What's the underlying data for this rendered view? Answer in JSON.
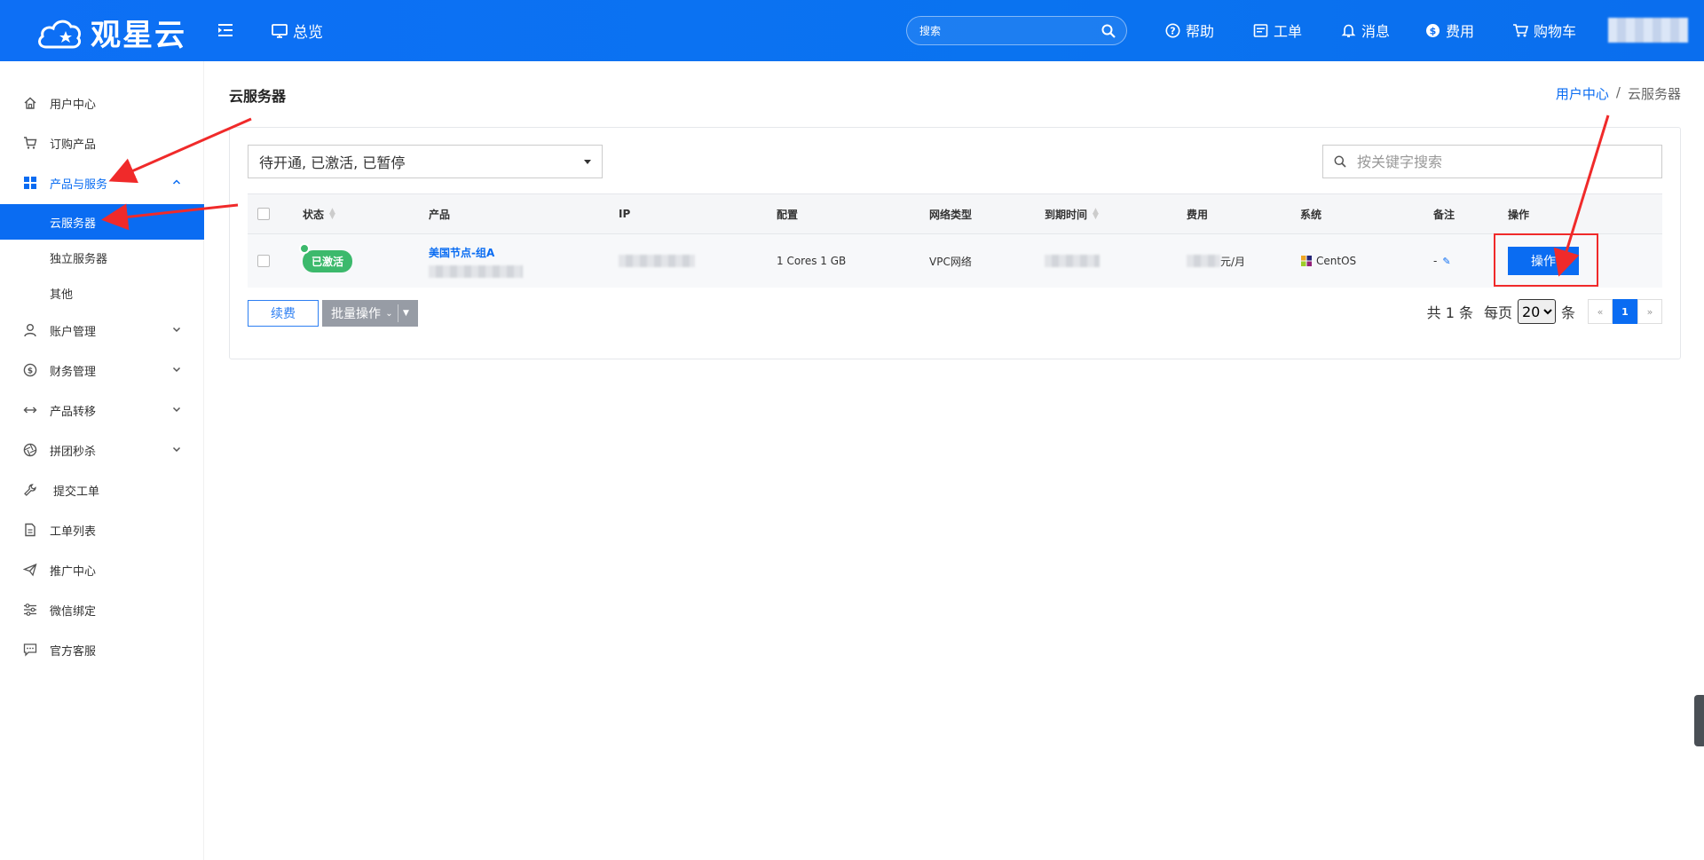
{
  "header": {
    "logo_text": "观星云",
    "overview": "总览",
    "search_placeholder": "搜索",
    "nav": [
      {
        "label": "帮助",
        "icon": "help-icon"
      },
      {
        "label": "工单",
        "icon": "ticket-icon"
      },
      {
        "label": "消息",
        "icon": "bell-icon"
      },
      {
        "label": "费用",
        "icon": "dollar-icon"
      },
      {
        "label": "购物车",
        "icon": "cart-icon"
      }
    ]
  },
  "sidebar": {
    "items": [
      {
        "label": "用户中心",
        "icon": "home-icon"
      },
      {
        "label": "订购产品",
        "icon": "cart-icon"
      },
      {
        "label": "产品与服务",
        "icon": "grid-icon"
      },
      {
        "label": "账户管理",
        "icon": "user-icon"
      },
      {
        "label": "财务管理",
        "icon": "dollar-icon"
      },
      {
        "label": "产品转移",
        "icon": "transfer-icon"
      },
      {
        "label": "拼团秒杀",
        "icon": "aperture-icon"
      },
      {
        "label": "提交工单",
        "icon": "wrench-icon"
      },
      {
        "label": "工单列表",
        "icon": "document-icon"
      },
      {
        "label": "推广中心",
        "icon": "send-icon"
      },
      {
        "label": "微信绑定",
        "icon": "sliders-icon"
      },
      {
        "label": "官方客服",
        "icon": "chat-icon"
      }
    ],
    "sub_items": [
      "云服务器",
      "独立服务器",
      "其他"
    ]
  },
  "page": {
    "title": "云服务器",
    "breadcrumb": {
      "home": "用户中心",
      "sep": "/",
      "current": "云服务器"
    }
  },
  "filters": {
    "status_selected": "待开通, 已激活, 已暂停",
    "keyword_placeholder": "按关键字搜索"
  },
  "table": {
    "columns": [
      "状态",
      "产品",
      "IP",
      "配置",
      "网络类型",
      "到期时间",
      "费用",
      "系统",
      "备注",
      "操作"
    ],
    "rows": [
      {
        "status": "已激活",
        "product": "美国节点-组A",
        "config": "1 Cores 1 GB",
        "network": "VPC网络",
        "fee_unit": "元/月",
        "os": "CentOS",
        "note": "-",
        "action": "操作"
      }
    ]
  },
  "footer": {
    "renew": "续费",
    "batch": "批量操作",
    "total": "共 1 条",
    "per_page_label": "每页",
    "per_page_value": "20",
    "per_page_unit": "条",
    "pages": {
      "prev": "«",
      "current": "1",
      "next": "»"
    }
  },
  "colors": {
    "primary": "#0a6cf2",
    "success": "#3cb96c",
    "annotation": "#f02a2a"
  }
}
